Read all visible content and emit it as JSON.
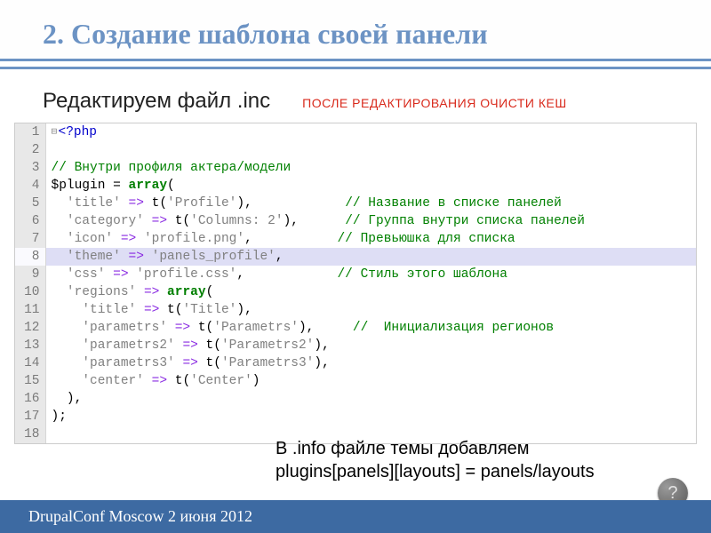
{
  "title": "2. Создание шаблона своей панели",
  "sub_title": "Редактируем файл  .inc",
  "sub_warning": "ПОСЛЕ РЕДАКТИРОВАНИЯ  ОЧИСТИ  КЕШ",
  "code": {
    "lines": [
      {
        "n": 1,
        "fold": "⊟",
        "tokens": [
          {
            "t": "<?php",
            "c": "c-tag"
          }
        ]
      },
      {
        "n": 2,
        "tokens": []
      },
      {
        "n": 3,
        "tokens": [
          {
            "t": "// Внутри профиля актера/модели",
            "c": "c-com"
          }
        ]
      },
      {
        "n": 4,
        "tokens": [
          {
            "t": "$plugin",
            "c": "c-var"
          },
          {
            "t": " = "
          },
          {
            "t": "array",
            "c": "c-kw"
          },
          {
            "t": "("
          }
        ]
      },
      {
        "n": 5,
        "tokens": [
          {
            "t": "  "
          },
          {
            "t": "'title'",
            "c": "c-str"
          },
          {
            "t": " "
          },
          {
            "t": "=>",
            "c": "c-arr"
          },
          {
            "t": " t("
          },
          {
            "t": "'Profile'",
            "c": "c-str"
          },
          {
            "t": "),            "
          },
          {
            "t": "// Название в списке панелей",
            "c": "c-com"
          }
        ]
      },
      {
        "n": 6,
        "tokens": [
          {
            "t": "  "
          },
          {
            "t": "'category'",
            "c": "c-str"
          },
          {
            "t": " "
          },
          {
            "t": "=>",
            "c": "c-arr"
          },
          {
            "t": " t("
          },
          {
            "t": "'Columns: 2'",
            "c": "c-str"
          },
          {
            "t": "),      "
          },
          {
            "t": "// Группа внутри списка панелей",
            "c": "c-com"
          }
        ]
      },
      {
        "n": 7,
        "tokens": [
          {
            "t": "  "
          },
          {
            "t": "'icon'",
            "c": "c-str"
          },
          {
            "t": " "
          },
          {
            "t": "=>",
            "c": "c-arr"
          },
          {
            "t": " "
          },
          {
            "t": "'profile.png'",
            "c": "c-str"
          },
          {
            "t": ",           "
          },
          {
            "t": "// Превьюшка для списка",
            "c": "c-com"
          }
        ]
      },
      {
        "n": 8,
        "hl": true,
        "tokens": [
          {
            "t": "  "
          },
          {
            "t": "'theme'",
            "c": "c-str"
          },
          {
            "t": " "
          },
          {
            "t": "=>",
            "c": "c-arr"
          },
          {
            "t": " "
          },
          {
            "t": "'panels_profile'",
            "c": "c-str"
          },
          {
            "t": ","
          }
        ]
      },
      {
        "n": 9,
        "tokens": [
          {
            "t": "  "
          },
          {
            "t": "'css'",
            "c": "c-str"
          },
          {
            "t": " "
          },
          {
            "t": "=>",
            "c": "c-arr"
          },
          {
            "t": " "
          },
          {
            "t": "'profile.css'",
            "c": "c-str"
          },
          {
            "t": ",            "
          },
          {
            "t": "// Стиль этого шаблона",
            "c": "c-com"
          }
        ]
      },
      {
        "n": 10,
        "tokens": [
          {
            "t": "  "
          },
          {
            "t": "'regions'",
            "c": "c-str"
          },
          {
            "t": " "
          },
          {
            "t": "=>",
            "c": "c-arr"
          },
          {
            "t": " "
          },
          {
            "t": "array",
            "c": "c-kw"
          },
          {
            "t": "("
          }
        ]
      },
      {
        "n": 11,
        "tokens": [
          {
            "t": "    "
          },
          {
            "t": "'title'",
            "c": "c-str"
          },
          {
            "t": " "
          },
          {
            "t": "=>",
            "c": "c-arr"
          },
          {
            "t": " t("
          },
          {
            "t": "'Title'",
            "c": "c-str"
          },
          {
            "t": "),"
          }
        ]
      },
      {
        "n": 12,
        "tokens": [
          {
            "t": "    "
          },
          {
            "t": "'parametrs'",
            "c": "c-str"
          },
          {
            "t": " "
          },
          {
            "t": "=>",
            "c": "c-arr"
          },
          {
            "t": " t("
          },
          {
            "t": "'Parametrs'",
            "c": "c-str"
          },
          {
            "t": "),     "
          },
          {
            "t": "//  Инициализация регионов",
            "c": "c-com"
          }
        ]
      },
      {
        "n": 13,
        "tokens": [
          {
            "t": "    "
          },
          {
            "t": "'parametrs2'",
            "c": "c-str"
          },
          {
            "t": " "
          },
          {
            "t": "=>",
            "c": "c-arr"
          },
          {
            "t": " t("
          },
          {
            "t": "'Parametrs2'",
            "c": "c-str"
          },
          {
            "t": "),"
          }
        ]
      },
      {
        "n": 14,
        "tokens": [
          {
            "t": "    "
          },
          {
            "t": "'parametrs3'",
            "c": "c-str"
          },
          {
            "t": " "
          },
          {
            "t": "=>",
            "c": "c-arr"
          },
          {
            "t": " t("
          },
          {
            "t": "'Parametrs3'",
            "c": "c-str"
          },
          {
            "t": "),"
          }
        ]
      },
      {
        "n": 15,
        "tokens": [
          {
            "t": "    "
          },
          {
            "t": "'center'",
            "c": "c-str"
          },
          {
            "t": " "
          },
          {
            "t": "=>",
            "c": "c-arr"
          },
          {
            "t": " t("
          },
          {
            "t": "'Center'",
            "c": "c-str"
          },
          {
            "t": ")"
          }
        ]
      },
      {
        "n": 16,
        "tokens": [
          {
            "t": "  ),"
          }
        ]
      },
      {
        "n": 17,
        "tokens": [
          {
            "t": ");"
          }
        ]
      },
      {
        "n": 18,
        "tokens": []
      }
    ]
  },
  "overlay_note_line1": "В .info файле темы добавляем",
  "overlay_note_line2": "plugins[panels][layouts] = panels/layouts",
  "footer_text": "DrupalConf Moscow 2 июня 2012",
  "help_symbol": "?"
}
